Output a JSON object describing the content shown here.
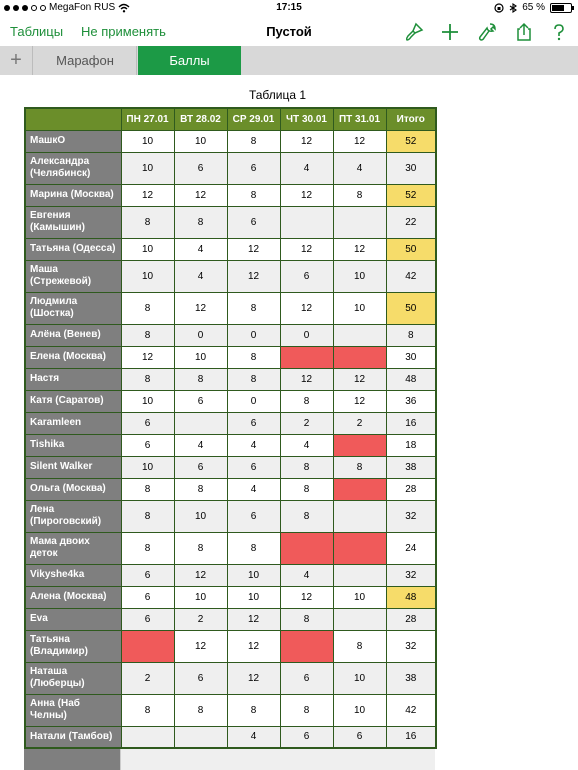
{
  "status": {
    "carrier": "MegaFon RUS",
    "time": "17:15",
    "battery": "65 %",
    "battery_level": 0.65
  },
  "toolbar": {
    "back_label": "Таблицы",
    "undo_label": "Не применять",
    "title": "Пустой",
    "icons": [
      "paintbrush-icon",
      "plus-icon",
      "wrench-icon",
      "share-icon",
      "help-icon"
    ],
    "accent_color": "#1e8f3a"
  },
  "sheets": {
    "add_label": "+",
    "tabs": [
      "Марафон",
      "Баллы"
    ],
    "active_tab": "Баллы"
  },
  "table": {
    "title": "Таблица 1",
    "columns": [
      "ПН 27.01",
      "ВТ 28.02",
      "СР 29.01",
      "ЧТ 30.01",
      "ПТ 31.01",
      "Итого"
    ],
    "colors": {
      "header": "#6b8e2a",
      "name_cell": "#7f7f7f",
      "missed": "#f05a5a",
      "highlight_total": "#f6dc6a"
    },
    "rows": [
      {
        "name": "МашкО",
        "values": [
          "10",
          "10",
          "8",
          "12",
          "12"
        ],
        "total": "52",
        "gold": true,
        "red": [],
        "tall": false
      },
      {
        "name": "Александра (Челябинск)",
        "values": [
          "10",
          "6",
          "6",
          "4",
          "4"
        ],
        "total": "30",
        "gold": false,
        "red": [],
        "tall": true
      },
      {
        "name": "Марина (Москва)",
        "values": [
          "12",
          "12",
          "8",
          "12",
          "8"
        ],
        "total": "52",
        "gold": true,
        "red": [],
        "tall": false
      },
      {
        "name": "Евгения (Камышин)",
        "values": [
          "8",
          "8",
          "6",
          "",
          ""
        ],
        "total": "22",
        "gold": false,
        "red": [
          3,
          4
        ],
        "tall": true
      },
      {
        "name": "Татьяна (Одесса)",
        "values": [
          "10",
          "4",
          "12",
          "12",
          "12"
        ],
        "total": "50",
        "gold": true,
        "red": [],
        "tall": false
      },
      {
        "name": "Маша (Стрежевой)",
        "values": [
          "10",
          "4",
          "12",
          "6",
          "10"
        ],
        "total": "42",
        "gold": false,
        "red": [],
        "tall": true
      },
      {
        "name": "Людмила (Шостка)",
        "values": [
          "8",
          "12",
          "8",
          "12",
          "10"
        ],
        "total": "50",
        "gold": true,
        "red": [],
        "tall": true
      },
      {
        "name": "Алёна (Венев)",
        "values": [
          "8",
          "0",
          "0",
          "0",
          ""
        ],
        "total": "8",
        "gold": false,
        "red": [
          4
        ],
        "tall": false
      },
      {
        "name": "Елена (Москва)",
        "values": [
          "12",
          "10",
          "8",
          "",
          ""
        ],
        "total": "30",
        "gold": false,
        "red": [
          3,
          4
        ],
        "tall": false
      },
      {
        "name": "Настя",
        "values": [
          "8",
          "8",
          "8",
          "12",
          "12"
        ],
        "total": "48",
        "gold": false,
        "red": [],
        "tall": false
      },
      {
        "name": "Катя (Саратов)",
        "values": [
          "10",
          "6",
          "0",
          "8",
          "12"
        ],
        "total": "36",
        "gold": false,
        "red": [],
        "tall": false
      },
      {
        "name": "Karamleen",
        "values": [
          "6",
          "",
          "6",
          "2",
          "2"
        ],
        "total": "16",
        "gold": false,
        "red": [
          1
        ],
        "tall": false
      },
      {
        "name": " Tishika",
        "values": [
          "6",
          "4",
          "4",
          "4",
          ""
        ],
        "total": "18",
        "gold": false,
        "red": [
          4
        ],
        "tall": false
      },
      {
        "name": "Silent Walker",
        "values": [
          "10",
          "6",
          "6",
          "8",
          "8"
        ],
        "total": "38",
        "gold": false,
        "red": [],
        "tall": false
      },
      {
        "name": "Ольга (Москва)",
        "values": [
          "8",
          "8",
          "4",
          "8",
          ""
        ],
        "total": "28",
        "gold": false,
        "red": [
          4
        ],
        "tall": false
      },
      {
        "name": "Лена (Пироговский)",
        "values": [
          "8",
          "10",
          "6",
          "8",
          ""
        ],
        "total": "32",
        "gold": false,
        "red": [
          4
        ],
        "tall": true
      },
      {
        "name": "Мама двоих деток",
        "values": [
          "8",
          "8",
          "8",
          "",
          ""
        ],
        "total": "24",
        "gold": false,
        "red": [
          3,
          4
        ],
        "tall": true
      },
      {
        "name": "Vikyshe4ka",
        "values": [
          "6",
          "12",
          "10",
          "4",
          ""
        ],
        "total": "32",
        "gold": false,
        "red": [
          4
        ],
        "tall": false
      },
      {
        "name": "Алена (Москва)",
        "values": [
          "6",
          "10",
          "10",
          "12",
          "10"
        ],
        "total": "48",
        "gold": true,
        "red": [],
        "tall": false
      },
      {
        "name": "Eva",
        "values": [
          "6",
          "2",
          "12",
          "8",
          ""
        ],
        "total": "28",
        "gold": false,
        "red": [
          4
        ],
        "tall": false
      },
      {
        "name": "Татьяна (Владимир)",
        "values": [
          "",
          "12",
          "12",
          "",
          "8"
        ],
        "total": "32",
        "gold": false,
        "red": [
          0,
          3
        ],
        "tall": true
      },
      {
        "name": "Наташа (Люберцы)",
        "values": [
          "2",
          "6",
          "12",
          "6",
          "10"
        ],
        "total": "38",
        "gold": false,
        "red": [],
        "tall": true
      },
      {
        "name": "Анна (Наб Челны)",
        "values": [
          "8",
          "8",
          "8",
          "8",
          "10"
        ],
        "total": "42",
        "gold": false,
        "red": [],
        "tall": true
      },
      {
        "name": "Натали (Тамбов)",
        "values": [
          "",
          "",
          "4",
          "6",
          "6"
        ],
        "total": "16",
        "gold": false,
        "red": [
          0,
          1
        ],
        "tall": false
      }
    ]
  }
}
